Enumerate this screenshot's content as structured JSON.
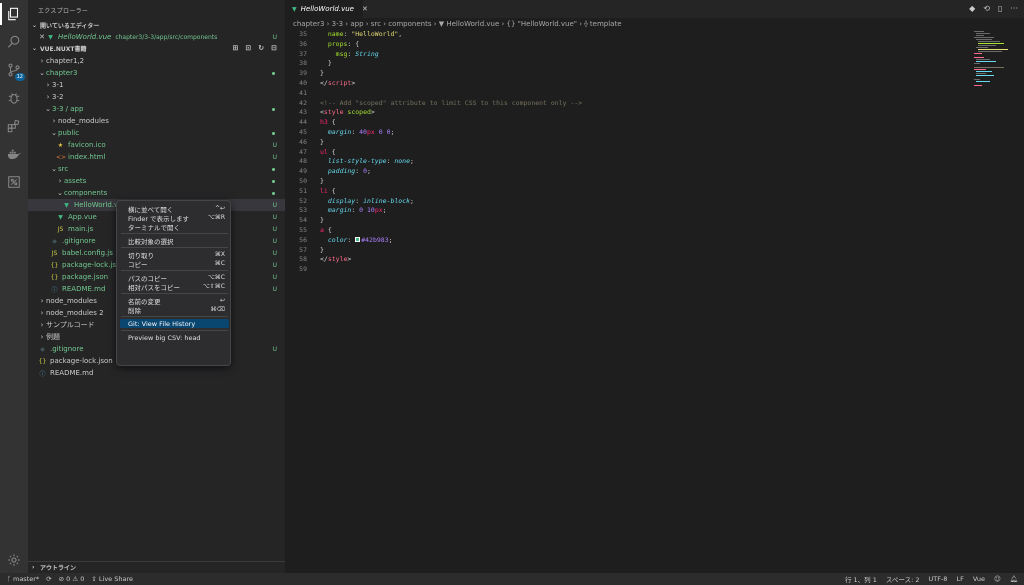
{
  "activity_bar": {
    "items": [
      {
        "name": "explorer",
        "icon": "files-icon",
        "active": true
      },
      {
        "name": "search",
        "icon": "search-icon"
      },
      {
        "name": "source-control",
        "icon": "source-control-icon",
        "badge": "12"
      },
      {
        "name": "debug",
        "icon": "debug-icon"
      },
      {
        "name": "extensions",
        "icon": "extensions-icon"
      },
      {
        "name": "docker",
        "icon": "docker-icon"
      },
      {
        "name": "remote",
        "icon": "remote-icon"
      }
    ],
    "settings_icon": "gear-icon"
  },
  "sidebar": {
    "title": "エクスプローラー",
    "open_editors_label": "開いているエディター",
    "open_editor": {
      "name": "HelloWorld.vue",
      "path": "chapter3/3-3/app/src/components",
      "status": "U"
    },
    "workspace_label": "VUE.NUXT書籍",
    "tree": [
      {
        "label": "chapter1,2",
        "indent": 1,
        "chev": "›",
        "status": ""
      },
      {
        "label": "chapter3",
        "indent": 1,
        "chev": "⌄",
        "status": "dot",
        "green": true
      },
      {
        "label": "3-1",
        "indent": 2,
        "chev": "›",
        "status": ""
      },
      {
        "label": "3-2",
        "indent": 2,
        "chev": "›",
        "status": ""
      },
      {
        "label": "3-3 / app",
        "indent": 2,
        "chev": "⌄",
        "status": "dot",
        "green": true
      },
      {
        "label": "node_modules",
        "indent": 3,
        "chev": "›",
        "status": ""
      },
      {
        "label": "public",
        "indent": 3,
        "chev": "⌄",
        "status": "dot",
        "green": true
      },
      {
        "label": "favicon.ico",
        "indent": 4,
        "icon": "★",
        "icls": "star",
        "status": "U",
        "green": true
      },
      {
        "label": "index.html",
        "indent": 4,
        "icon": "<>",
        "icls": "html",
        "status": "U",
        "green": true
      },
      {
        "label": "src",
        "indent": 3,
        "chev": "⌄",
        "status": "dot",
        "green": true
      },
      {
        "label": "assets",
        "indent": 4,
        "chev": "›",
        "status": "dot",
        "green": true
      },
      {
        "label": "components",
        "indent": 4,
        "chev": "⌄",
        "status": "dot",
        "green": true
      },
      {
        "label": "HelloWorld.vue",
        "indent": 5,
        "icon": "▼",
        "icls": "vue",
        "status": "U",
        "green": true,
        "selected": true
      },
      {
        "label": "App.vue",
        "indent": 4,
        "icon": "▼",
        "icls": "vue",
        "status": "U",
        "green": true
      },
      {
        "label": "main.js",
        "indent": 4,
        "icon": "JS",
        "icls": "js",
        "status": "U",
        "green": true
      },
      {
        "label": ".gitignore",
        "indent": 3,
        "icon": "◆",
        "icls": "git",
        "status": "U",
        "green": true
      },
      {
        "label": "babel.config.js",
        "indent": 3,
        "icon": "JS",
        "icls": "js",
        "status": "U",
        "green": true
      },
      {
        "label": "package-lock.json",
        "indent": 3,
        "icon": "{}",
        "icls": "json",
        "status": "U",
        "green": true
      },
      {
        "label": "package.json",
        "indent": 3,
        "icon": "{}",
        "icls": "json",
        "status": "U",
        "green": true
      },
      {
        "label": "README.md",
        "indent": 3,
        "icon": "ⓘ",
        "icls": "md",
        "status": "U",
        "green": true
      },
      {
        "label": "node_modules",
        "indent": 1,
        "chev": "›",
        "status": ""
      },
      {
        "label": "node_modules 2",
        "indent": 1,
        "chev": "›",
        "status": ""
      },
      {
        "label": "サンプルコード",
        "indent": 1,
        "chev": "›",
        "status": ""
      },
      {
        "label": "例題",
        "indent": 1,
        "chev": "›",
        "status": ""
      },
      {
        "label": ".gitignore",
        "indent": 1,
        "icon": "◆",
        "icls": "git",
        "status": "U",
        "green": true
      },
      {
        "label": "package-lock.json",
        "indent": 1,
        "icon": "{}",
        "icls": "json",
        "status": ""
      },
      {
        "label": "README.md",
        "indent": 1,
        "icon": "ⓘ",
        "icls": "md",
        "status": ""
      }
    ],
    "outline_label": "アウトライン"
  },
  "editor": {
    "tab": {
      "label": "HelloWorld.vue"
    },
    "breadcrumb": "chapter3 › 3-3 › app › src › components › ▼ HelloWorld.vue › {} \"HelloWorld.vue\" › ⟠ template",
    "lines": [
      {
        "n": "35",
        "html": "  <span class='k-attr'>name</span>: <span class='k-str'>\"HelloWorld\"</span>,"
      },
      {
        "n": "36",
        "html": "  <span class='k-attr'>props</span>: {"
      },
      {
        "n": "37",
        "html": "    <span class='k-attr'>msg</span>: <span class='k-type'>String</span>"
      },
      {
        "n": "38",
        "html": "  }"
      },
      {
        "n": "39",
        "html": "}"
      },
      {
        "n": "40",
        "html": "&lt;/<span class='k-tag'>script</span>&gt;"
      },
      {
        "n": "41",
        "html": ""
      },
      {
        "n": "42",
        "html": "<span class='k-com'>&lt;!-- Add \"scoped\" attribute to limit CSS to this component only --&gt;</span>"
      },
      {
        "n": "43",
        "html": "&lt;<span class='k-tag'>style</span> <span class='k-attr'>scoped</span>&gt;"
      },
      {
        "n": "44",
        "html": "<span class='k-sel'>h3</span> {"
      },
      {
        "n": "45",
        "html": "  <span class='k-prop'>margin</span>: <span class='k-num'>40</span><span class='k-sel'>px</span> <span class='k-num'>0</span> <span class='k-num'>0</span>;"
      },
      {
        "n": "46",
        "html": "}"
      },
      {
        "n": "47",
        "html": "<span class='k-sel'>ul</span> {"
      },
      {
        "n": "48",
        "html": "  <span class='k-prop'>list-style-type</span>: <span class='k-prop'>none</span>;"
      },
      {
        "n": "49",
        "html": "  <span class='k-prop'>padding</span>: <span class='k-num'>0</span>;"
      },
      {
        "n": "50",
        "html": "}"
      },
      {
        "n": "51",
        "html": "<span class='k-sel'>li</span> {"
      },
      {
        "n": "52",
        "html": "  <span class='k-prop'>display</span>: <span class='k-prop'>inline-block</span>;"
      },
      {
        "n": "53",
        "html": "  <span class='k-prop'>margin</span>: <span class='k-num'>0</span> <span class='k-num'>10</span><span class='k-sel'>px</span>;"
      },
      {
        "n": "54",
        "html": "}"
      },
      {
        "n": "55",
        "html": "<span class='k-sel'>a</span> {"
      },
      {
        "n": "56",
        "html": "  <span class='k-prop'>color</span>: <span class='swatch'></span><span class='k-num'>#42b983</span>;"
      },
      {
        "n": "57",
        "html": "}"
      },
      {
        "n": "58",
        "html": "&lt;/<span class='k-tag'>style</span>&gt;"
      },
      {
        "n": "59",
        "html": ""
      }
    ]
  },
  "context_menu": {
    "items": [
      {
        "label": "横に並べて開く",
        "shortcut": "^↩"
      },
      {
        "label": "Finder で表示します",
        "shortcut": "⌥⌘R"
      },
      {
        "label": "ターミナルで開く",
        "shortcut": ""
      },
      {
        "sep": true
      },
      {
        "label": "比較対象の選択",
        "shortcut": ""
      },
      {
        "sep": true
      },
      {
        "label": "切り取り",
        "shortcut": "⌘X"
      },
      {
        "label": "コピー",
        "shortcut": "⌘C"
      },
      {
        "sep": true
      },
      {
        "label": "パスのコピー",
        "shortcut": "⌥⌘C"
      },
      {
        "label": "相対パスをコピー",
        "shortcut": "⌥⇧⌘C"
      },
      {
        "sep": true
      },
      {
        "label": "名前の変更",
        "shortcut": "↩"
      },
      {
        "label": "削除",
        "shortcut": "⌘⌫"
      },
      {
        "sep": true
      },
      {
        "label": "Git: View File History",
        "shortcut": "",
        "highlighted": true
      },
      {
        "sep": true
      },
      {
        "label": "Preview big CSV: head",
        "shortcut": ""
      }
    ]
  },
  "status_bar": {
    "branch": "master*",
    "sync": "⟳",
    "problems": "⊘ 0 ⚠ 0",
    "live_share": "Live Share",
    "position": "行 1、列 1",
    "spaces": "スペース: 2",
    "encoding": "UTF-8",
    "eol": "LF",
    "language": "Vue"
  }
}
